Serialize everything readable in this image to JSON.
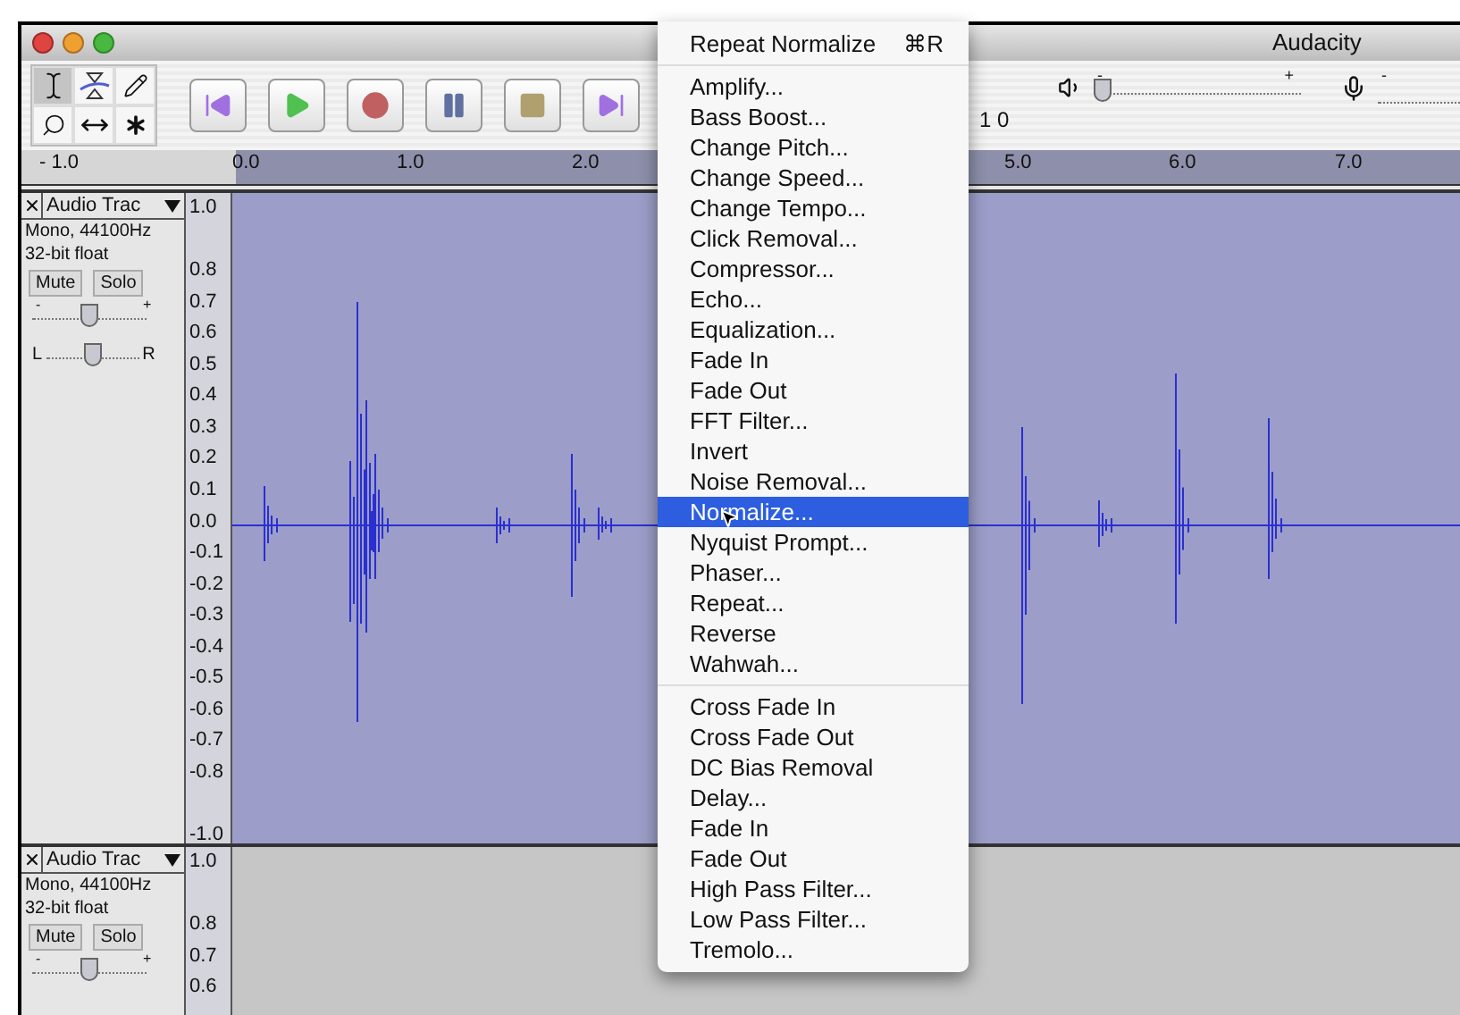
{
  "window": {
    "title": "Audacity"
  },
  "tools": [
    {
      "kind": "select",
      "selected": true
    },
    {
      "kind": "envelope",
      "selected": false
    },
    {
      "kind": "draw",
      "selected": false
    },
    {
      "kind": "zoom",
      "selected": false
    },
    {
      "kind": "timeshift",
      "selected": false
    },
    {
      "kind": "multi",
      "selected": false
    }
  ],
  "meter_fragment": "1 0",
  "mixer": {
    "output": {
      "minus": "-",
      "plus": "+",
      "level": 0.04
    },
    "input": {
      "minus": "-"
    }
  },
  "ruler": {
    "labels": [
      "- 1.0",
      "0.0",
      "1.0",
      "2.0",
      "5.0",
      "6.0",
      "7.0"
    ]
  },
  "tracks": [
    {
      "name": "Audio Trac",
      "format": "Mono, 44100Hz",
      "depth": "32-bit float",
      "mute": "Mute",
      "solo": "Solo",
      "selected": true,
      "gain": {
        "minus": "-",
        "plus": "+",
        "level": 0.5
      },
      "pan": {
        "left": "L",
        "right": "R",
        "level": 0.5
      },
      "scale": [
        "1.0",
        "0.8",
        "0.7",
        "0.6",
        "0.5",
        "0.4",
        "0.3",
        "0.2",
        "0.1",
        "0.0",
        "-0.1",
        "-0.2",
        "-0.3",
        "-0.4",
        "-0.5",
        "-0.6",
        "-0.7",
        "-0.8",
        "-1.0"
      ]
    },
    {
      "name": "Audio Trac",
      "format": "Mono, 44100Hz",
      "depth": "32-bit float",
      "mute": "Mute",
      "solo": "Solo",
      "selected": false,
      "gain": {
        "minus": "-",
        "plus": "+",
        "level": 0.5
      },
      "scale": [
        "1.0",
        "0.8",
        "0.7",
        "0.6"
      ]
    }
  ],
  "menu": {
    "sections": [
      [
        {
          "label": "Repeat Normalize",
          "shortcut": "⌘R",
          "selected": false
        }
      ],
      [
        {
          "label": "Amplify...",
          "selected": false
        },
        {
          "label": "Bass Boost...",
          "selected": false
        },
        {
          "label": "Change Pitch...",
          "selected": false
        },
        {
          "label": "Change Speed...",
          "selected": false
        },
        {
          "label": "Change Tempo...",
          "selected": false
        },
        {
          "label": "Click Removal...",
          "selected": false
        },
        {
          "label": "Compressor...",
          "selected": false
        },
        {
          "label": "Echo...",
          "selected": false
        },
        {
          "label": "Equalization...",
          "selected": false
        },
        {
          "label": "Fade In",
          "selected": false
        },
        {
          "label": "Fade Out",
          "selected": false
        },
        {
          "label": "FFT Filter...",
          "selected": false
        },
        {
          "label": "Invert",
          "selected": false
        },
        {
          "label": "Noise Removal...",
          "selected": false
        },
        {
          "label": "Normalize...",
          "selected": true
        },
        {
          "label": "Nyquist Prompt...",
          "selected": false
        },
        {
          "label": "Phaser...",
          "selected": false
        },
        {
          "label": "Repeat...",
          "selected": false
        },
        {
          "label": "Reverse",
          "selected": false
        },
        {
          "label": "Wahwah...",
          "selected": false
        }
      ],
      [
        {
          "label": "Cross Fade In",
          "selected": false
        },
        {
          "label": "Cross Fade Out",
          "selected": false
        },
        {
          "label": "DC Bias Removal",
          "selected": false
        },
        {
          "label": "Delay...",
          "selected": false
        },
        {
          "label": "Fade In",
          "selected": false
        },
        {
          "label": "Fade Out",
          "selected": false
        },
        {
          "label": "High Pass Filter...",
          "selected": false
        },
        {
          "label": "Low Pass Filter...",
          "selected": false
        },
        {
          "label": "Tremolo...",
          "selected": false
        }
      ]
    ]
  }
}
